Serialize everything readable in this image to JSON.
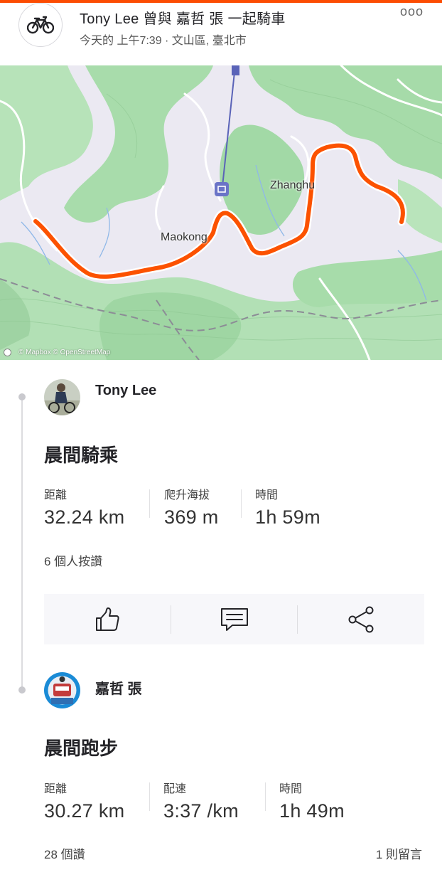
{
  "header": {
    "sport_icon": "bicycle-icon",
    "title": "Tony Lee 曾與 嘉哲 張 一起騎車",
    "subtitle": "今天的 上午7:39 · 文山區, 臺北市",
    "more_icon": "ooo"
  },
  "map": {
    "labels": {
      "zhanghu": "Zhanghu",
      "maokong": "Maokong"
    },
    "credit": "© Mapbox © OpenStreetMap",
    "route_color": "#fc5200"
  },
  "activities": [
    {
      "athlete": "Tony Lee",
      "title": "晨間騎乘",
      "stats": [
        {
          "label": "距離",
          "value": "32.24 km"
        },
        {
          "label": "爬升海拔",
          "value": "369 m"
        },
        {
          "label": "時間",
          "value": "1h 59m"
        }
      ],
      "kudos": "6 個人按讚",
      "actions": [
        "thumbs-up-icon",
        "comment-icon",
        "share-icon"
      ]
    },
    {
      "athlete": "嘉哲 張",
      "title": "晨間跑步",
      "stats": [
        {
          "label": "距離",
          "value": "30.27 km"
        },
        {
          "label": "配速",
          "value": "3:37 /km"
        },
        {
          "label": "時間",
          "value": "1h 49m"
        }
      ],
      "kudos": "28 個讚",
      "comments": "1 則留言"
    }
  ],
  "colors": {
    "accent": "#fc4c02",
    "text": "#242428"
  }
}
